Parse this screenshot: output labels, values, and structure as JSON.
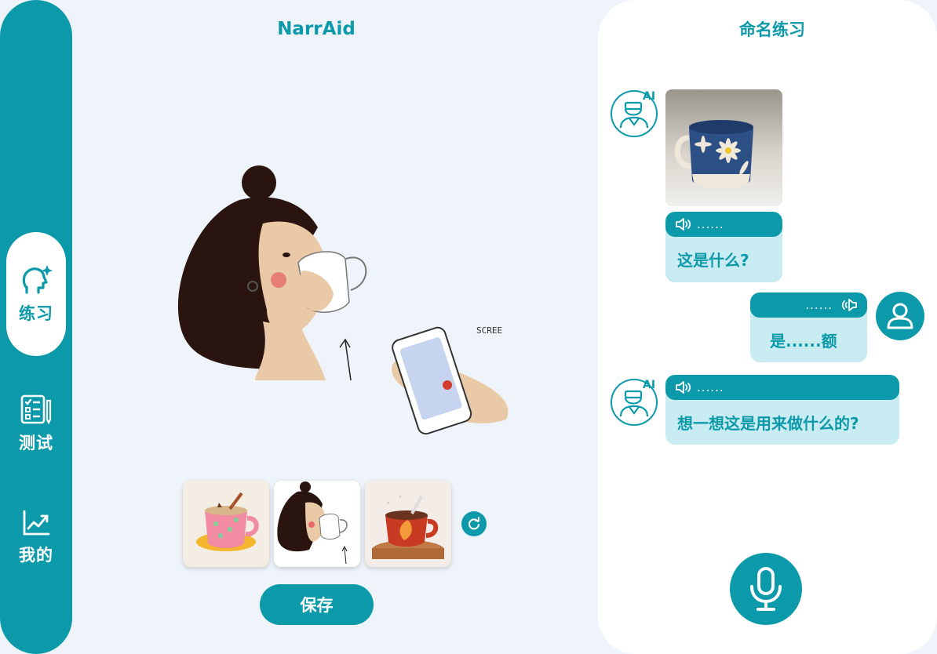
{
  "app": {
    "title": "NarrAid"
  },
  "colors": {
    "primary": "#0c9aab",
    "bubble": "#c9ebf2",
    "background": "#eef4fa"
  },
  "sidebar": {
    "items": [
      {
        "label": "练习",
        "icon": "head-sparkle-icon",
        "active": true
      },
      {
        "label": "测试",
        "icon": "checklist-icon",
        "active": false
      },
      {
        "label": "我的",
        "icon": "trend-chart-icon",
        "active": false
      }
    ]
  },
  "main": {
    "illustration": "woman-drinking-from-cup-illustration",
    "scribble_text": "SCREE",
    "thumbnails": [
      {
        "icon": "pink-mug-thumbnail"
      },
      {
        "icon": "woman-drinking-thumbnail"
      },
      {
        "icon": "red-cup-thumbnail"
      }
    ],
    "refresh_icon": "refresh-icon",
    "save_label": "保存"
  },
  "chat": {
    "title": "命名练习",
    "messages": [
      {
        "sender": "ai",
        "image": "blue-flower-mug-photo",
        "audio_label": "......",
        "text": "这是什么?"
      },
      {
        "sender": "user",
        "audio_label": "......",
        "text": "是......额"
      },
      {
        "sender": "ai",
        "audio_label": "......",
        "text": "想一想这是用来做什么的?"
      }
    ],
    "ai_badge": "AI",
    "mic_icon": "microphone-icon"
  }
}
